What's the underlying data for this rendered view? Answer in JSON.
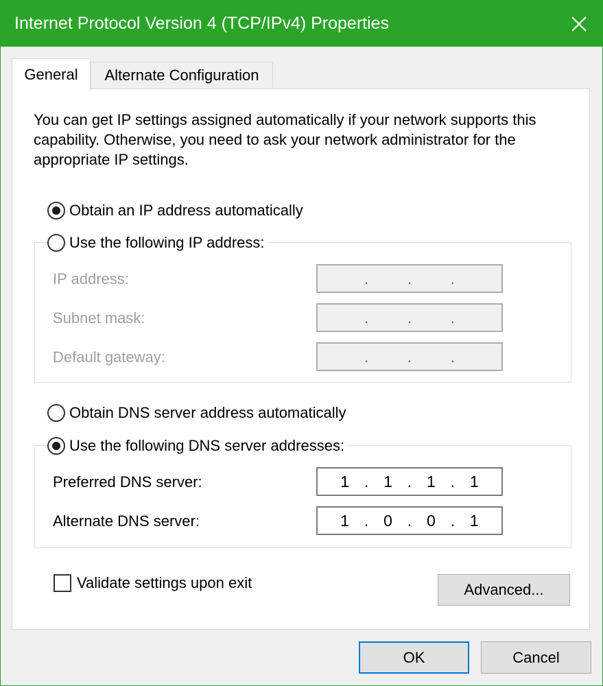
{
  "window": {
    "title": "Internet Protocol Version 4 (TCP/IPv4) Properties",
    "accent_color": "#2aa52a",
    "close_icon": "close-icon"
  },
  "tabs": [
    {
      "label": "General",
      "active": true
    },
    {
      "label": "Alternate Configuration",
      "active": false
    }
  ],
  "general": {
    "description": "You can get IP settings assigned automatically if your network supports this capability. Otherwise, you need to ask your network administrator for the appropriate IP settings.",
    "ip_mode": {
      "auto_label": "Obtain an IP address automatically",
      "auto_checked": true,
      "manual_label": "Use the following IP address:",
      "manual_checked": false
    },
    "ip_fields": {
      "ip_address": {
        "label": "IP address:",
        "octets": [
          "",
          "",
          "",
          ""
        ]
      },
      "subnet_mask": {
        "label": "Subnet mask:",
        "octets": [
          "",
          "",
          "",
          ""
        ]
      },
      "default_gateway": {
        "label": "Default gateway:",
        "octets": [
          "",
          "",
          "",
          ""
        ]
      }
    },
    "dns_mode": {
      "auto_label": "Obtain DNS server address automatically",
      "auto_checked": false,
      "manual_label": "Use the following DNS server addresses:",
      "manual_checked": true
    },
    "dns_fields": {
      "preferred": {
        "label": "Preferred DNS server:",
        "octets": [
          "1",
          "1",
          "1",
          "1"
        ]
      },
      "alternate": {
        "label": "Alternate DNS server:",
        "octets": [
          "1",
          "0",
          "0",
          "1"
        ]
      }
    },
    "validate_label": "Validate settings upon exit",
    "validate_checked": false,
    "advanced_label": "Advanced..."
  },
  "footer": {
    "ok_label": "OK",
    "cancel_label": "Cancel"
  }
}
